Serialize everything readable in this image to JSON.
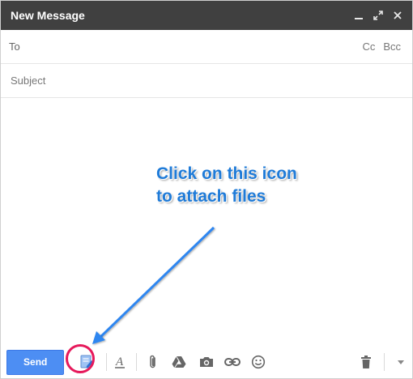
{
  "window": {
    "title": "New Message",
    "controls": [
      {
        "name": "minimize-icon",
        "glyph": "_"
      },
      {
        "name": "expand-icon",
        "glyph": "⤢"
      },
      {
        "name": "close-icon",
        "glyph": "✕"
      }
    ]
  },
  "to": {
    "label": "To",
    "value": "",
    "cc_label": "Cc",
    "bcc_label": "Bcc"
  },
  "subject": {
    "placeholder": "Subject",
    "value": ""
  },
  "body": {
    "value": ""
  },
  "annotation": {
    "line1": "Click on this icon",
    "line2": "to attach files"
  },
  "toolbar": {
    "send_label": "Send",
    "icons": [
      "attach-note-icon",
      "text-formatting-icon",
      "attach-files-icon",
      "google-drive-icon",
      "insert-photo-icon",
      "insert-link-icon",
      "insert-emoji-icon",
      "discard-draft-icon",
      "more-options-icon"
    ]
  },
  "colors": {
    "titlebar": "#404040",
    "send_button": "#4d8ef3",
    "annotation_text": "#1f7bd8",
    "highlight_ring": "#e6195b",
    "arrow": "#2e86f0"
  }
}
